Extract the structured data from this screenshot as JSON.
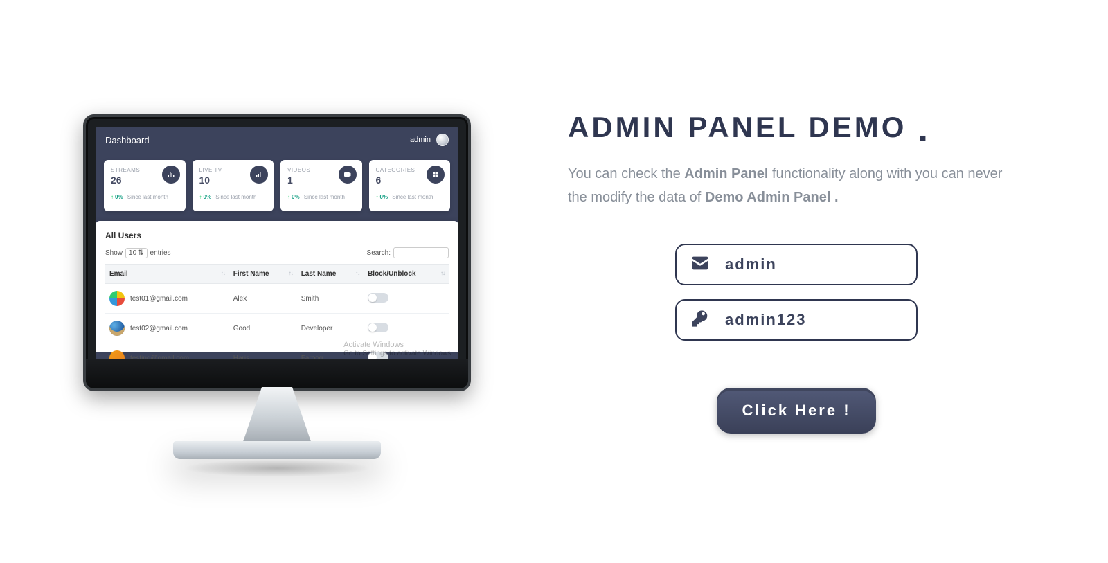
{
  "promo": {
    "heading": "ADMIN PANEL DEMO",
    "heading_dot": ".",
    "desc_part1": "You can check the ",
    "desc_bold1": "Admin Panel",
    "desc_part2": " functionality along with you can never the modify the data of ",
    "desc_bold2": "Demo Admin Panel .",
    "username": "admin",
    "password": "admin123",
    "cta": "Click Here !"
  },
  "dashboard": {
    "title": "Dashboard",
    "account": "admin",
    "cards": [
      {
        "label": "STREAMS",
        "value": "26",
        "change_pct": "0%",
        "since": "Since last month"
      },
      {
        "label": "LIVE TV",
        "value": "10",
        "change_pct": "0%",
        "since": "Since last month"
      },
      {
        "label": "VIDEOS",
        "value": "1",
        "change_pct": "0%",
        "since": "Since last month"
      },
      {
        "label": "CATEGORIES",
        "value": "6",
        "change_pct": "0%",
        "since": "Since last month"
      }
    ],
    "users": {
      "panel_title": "All Users",
      "show_label": "Show",
      "entries_label": "entries",
      "page_size": "10",
      "search_label": "Search:",
      "headers": {
        "email": "Email",
        "first": "First Name",
        "last": "Last Name",
        "block": "Block/Unblock"
      },
      "rows": [
        {
          "email": "test01@gmail.com",
          "first": "Alex",
          "last": "Smith"
        },
        {
          "email": "test02@gmail.com",
          "first": "Good",
          "last": "Developer"
        },
        {
          "email": "testing@gmail.com",
          "first": "Haris",
          "last": "Farooq"
        }
      ]
    },
    "watermark": {
      "line1": "Activate Windows",
      "line2": "Go to Settings to activate Windows."
    }
  }
}
